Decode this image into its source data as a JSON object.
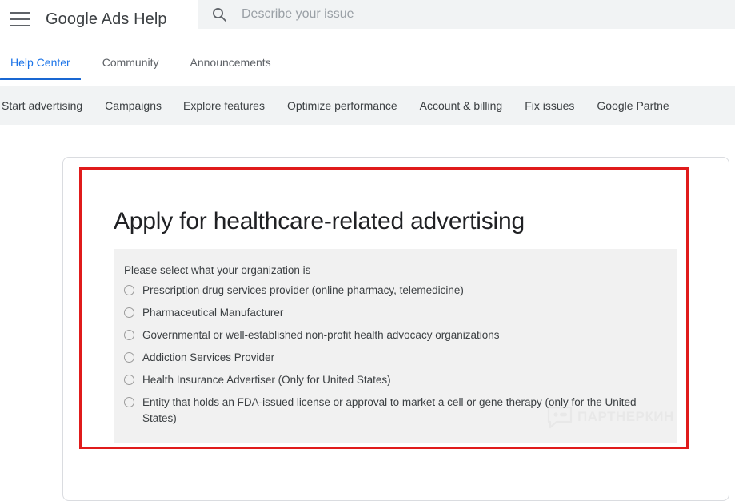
{
  "header": {
    "menu_icon": "hamburger-menu-icon",
    "brand": "Google Ads Help",
    "search_icon": "search-icon",
    "search_placeholder": "Describe your issue",
    "search_value": ""
  },
  "tabs": [
    {
      "label": "Help Center",
      "active": true
    },
    {
      "label": "Community",
      "active": false
    },
    {
      "label": "Announcements",
      "active": false
    }
  ],
  "subnav": [
    {
      "label": "Start advertising"
    },
    {
      "label": "Campaigns"
    },
    {
      "label": "Explore features"
    },
    {
      "label": "Optimize performance"
    },
    {
      "label": "Account & billing"
    },
    {
      "label": "Fix issues"
    },
    {
      "label": "Google Partne"
    }
  ],
  "main": {
    "page_title": "Apply for healthcare-related advertising",
    "form": {
      "prompt": "Please select what your organization is",
      "options": [
        {
          "label": "Prescription drug services provider (online pharmacy, telemedicine)",
          "selected": false
        },
        {
          "label": "Pharmaceutical Manufacturer",
          "selected": false
        },
        {
          "label": "Governmental or well-established non-profit health advocacy organizations",
          "selected": false
        },
        {
          "label": "Addiction Services Provider",
          "selected": false
        },
        {
          "label": "Health Insurance Advertiser (Only for United States)",
          "selected": false
        },
        {
          "label": "Entity that holds an FDA-issued license or approval to market a cell or gene therapy (only for the United States)",
          "selected": false
        }
      ]
    }
  },
  "watermark": {
    "text": "ПАРТНЕРКИН",
    "icon": "chat-bubble-icon"
  },
  "colors": {
    "accent_blue": "#1a73e8",
    "tab_underline": "#1967d2",
    "annotation_red": "#e01b1b",
    "subnav_bg": "#f1f3f4",
    "panel_bg": "#f1f1f1",
    "text_primary": "#3c4043",
    "text_title": "#202124"
  }
}
